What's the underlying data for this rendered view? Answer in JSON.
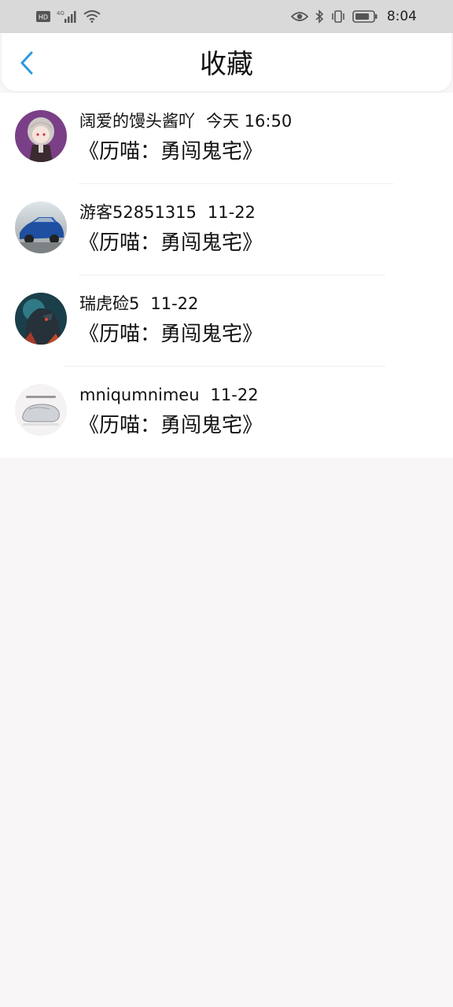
{
  "status_bar": {
    "hd": "HD",
    "network": "4G",
    "time": "8:04",
    "icons": [
      "signal-icon",
      "wifi-icon",
      "eye-icon",
      "bluetooth-icon",
      "vibrate-icon",
      "battery-icon"
    ]
  },
  "header": {
    "title": "收藏",
    "back_icon": "chevron-left-icon",
    "accent_color": "#2a9be0"
  },
  "favorites": [
    {
      "user": "阔爱的馒头酱吖",
      "date": "今天 16:50",
      "title": "《历喵：勇闯鬼宅》",
      "avatar": "anime-girl-avatar"
    },
    {
      "user": "游客52851315",
      "date": "11-22",
      "title": "《历喵：勇闯鬼宅》",
      "avatar": "blue-car-avatar"
    },
    {
      "user": "瑞虎硷5",
      "date": "11-22",
      "title": "《历喵：勇闯鬼宅》",
      "avatar": "dark-wolf-avatar"
    },
    {
      "user": "mniqumnimeu",
      "date": "11-22",
      "title": "《历喵：勇闯鬼宅》",
      "avatar": "mouse-avatar"
    }
  ]
}
